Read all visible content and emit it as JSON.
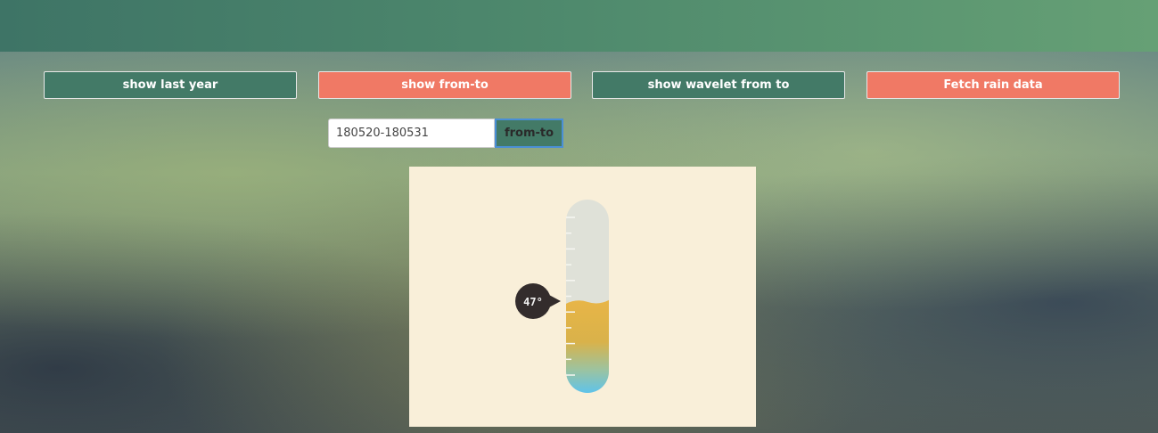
{
  "toolbar": {
    "show_last_year": "show last year",
    "show_from_to": "show from-to",
    "show_wavelet": "show wavelet from to",
    "fetch_rain": "Fetch rain data"
  },
  "range": {
    "value": "180520-180531",
    "submit_label": "from-to"
  },
  "thermometer": {
    "temperature_label": "47°",
    "fill_level": 0.48,
    "colors": {
      "panel_bg": "#f9efd9",
      "tube_bg": "#dfe1d8",
      "fill_top": "#e8b547",
      "fill_bottom": "#5fc3ea",
      "bubble": "#332c2c"
    }
  },
  "colors": {
    "green_button": "#437a67",
    "salmon_button": "#f07965",
    "topbar_start": "#3e7466",
    "topbar_end": "#66a075"
  }
}
